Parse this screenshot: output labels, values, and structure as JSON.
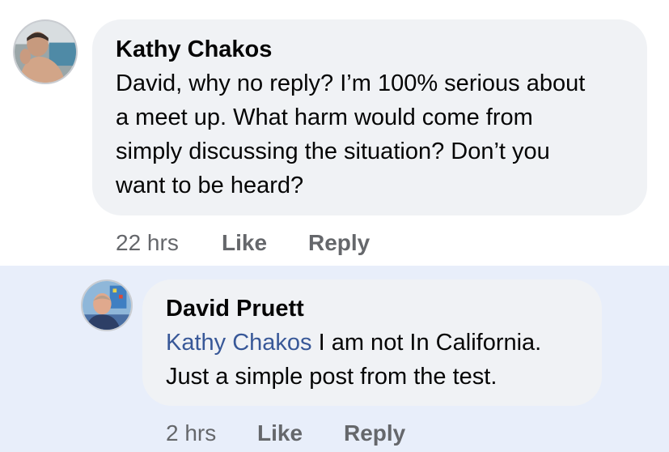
{
  "comments": [
    {
      "author": "Kathy Chakos",
      "lines": [
        "David, why no reply? I’m 100% serious about",
        "a meet up. What harm would come from",
        "simply discussing the situation? Don’t you",
        "want to be heard?"
      ],
      "time": "22 hrs",
      "like_label": "Like",
      "reply_label": "Reply"
    },
    {
      "author": "David Pruett",
      "mention": "Kathy Chakos",
      "first_line_rest": " I am not In California.",
      "lines": [
        "Just a simple post from the test."
      ],
      "time": "2 hrs",
      "like_label": "Like",
      "reply_label": "Reply"
    }
  ],
  "colors": {
    "bubble": "#f0f2f5",
    "highlight": "#e8eefa",
    "mention": "#385898",
    "meta": "#65676b"
  }
}
